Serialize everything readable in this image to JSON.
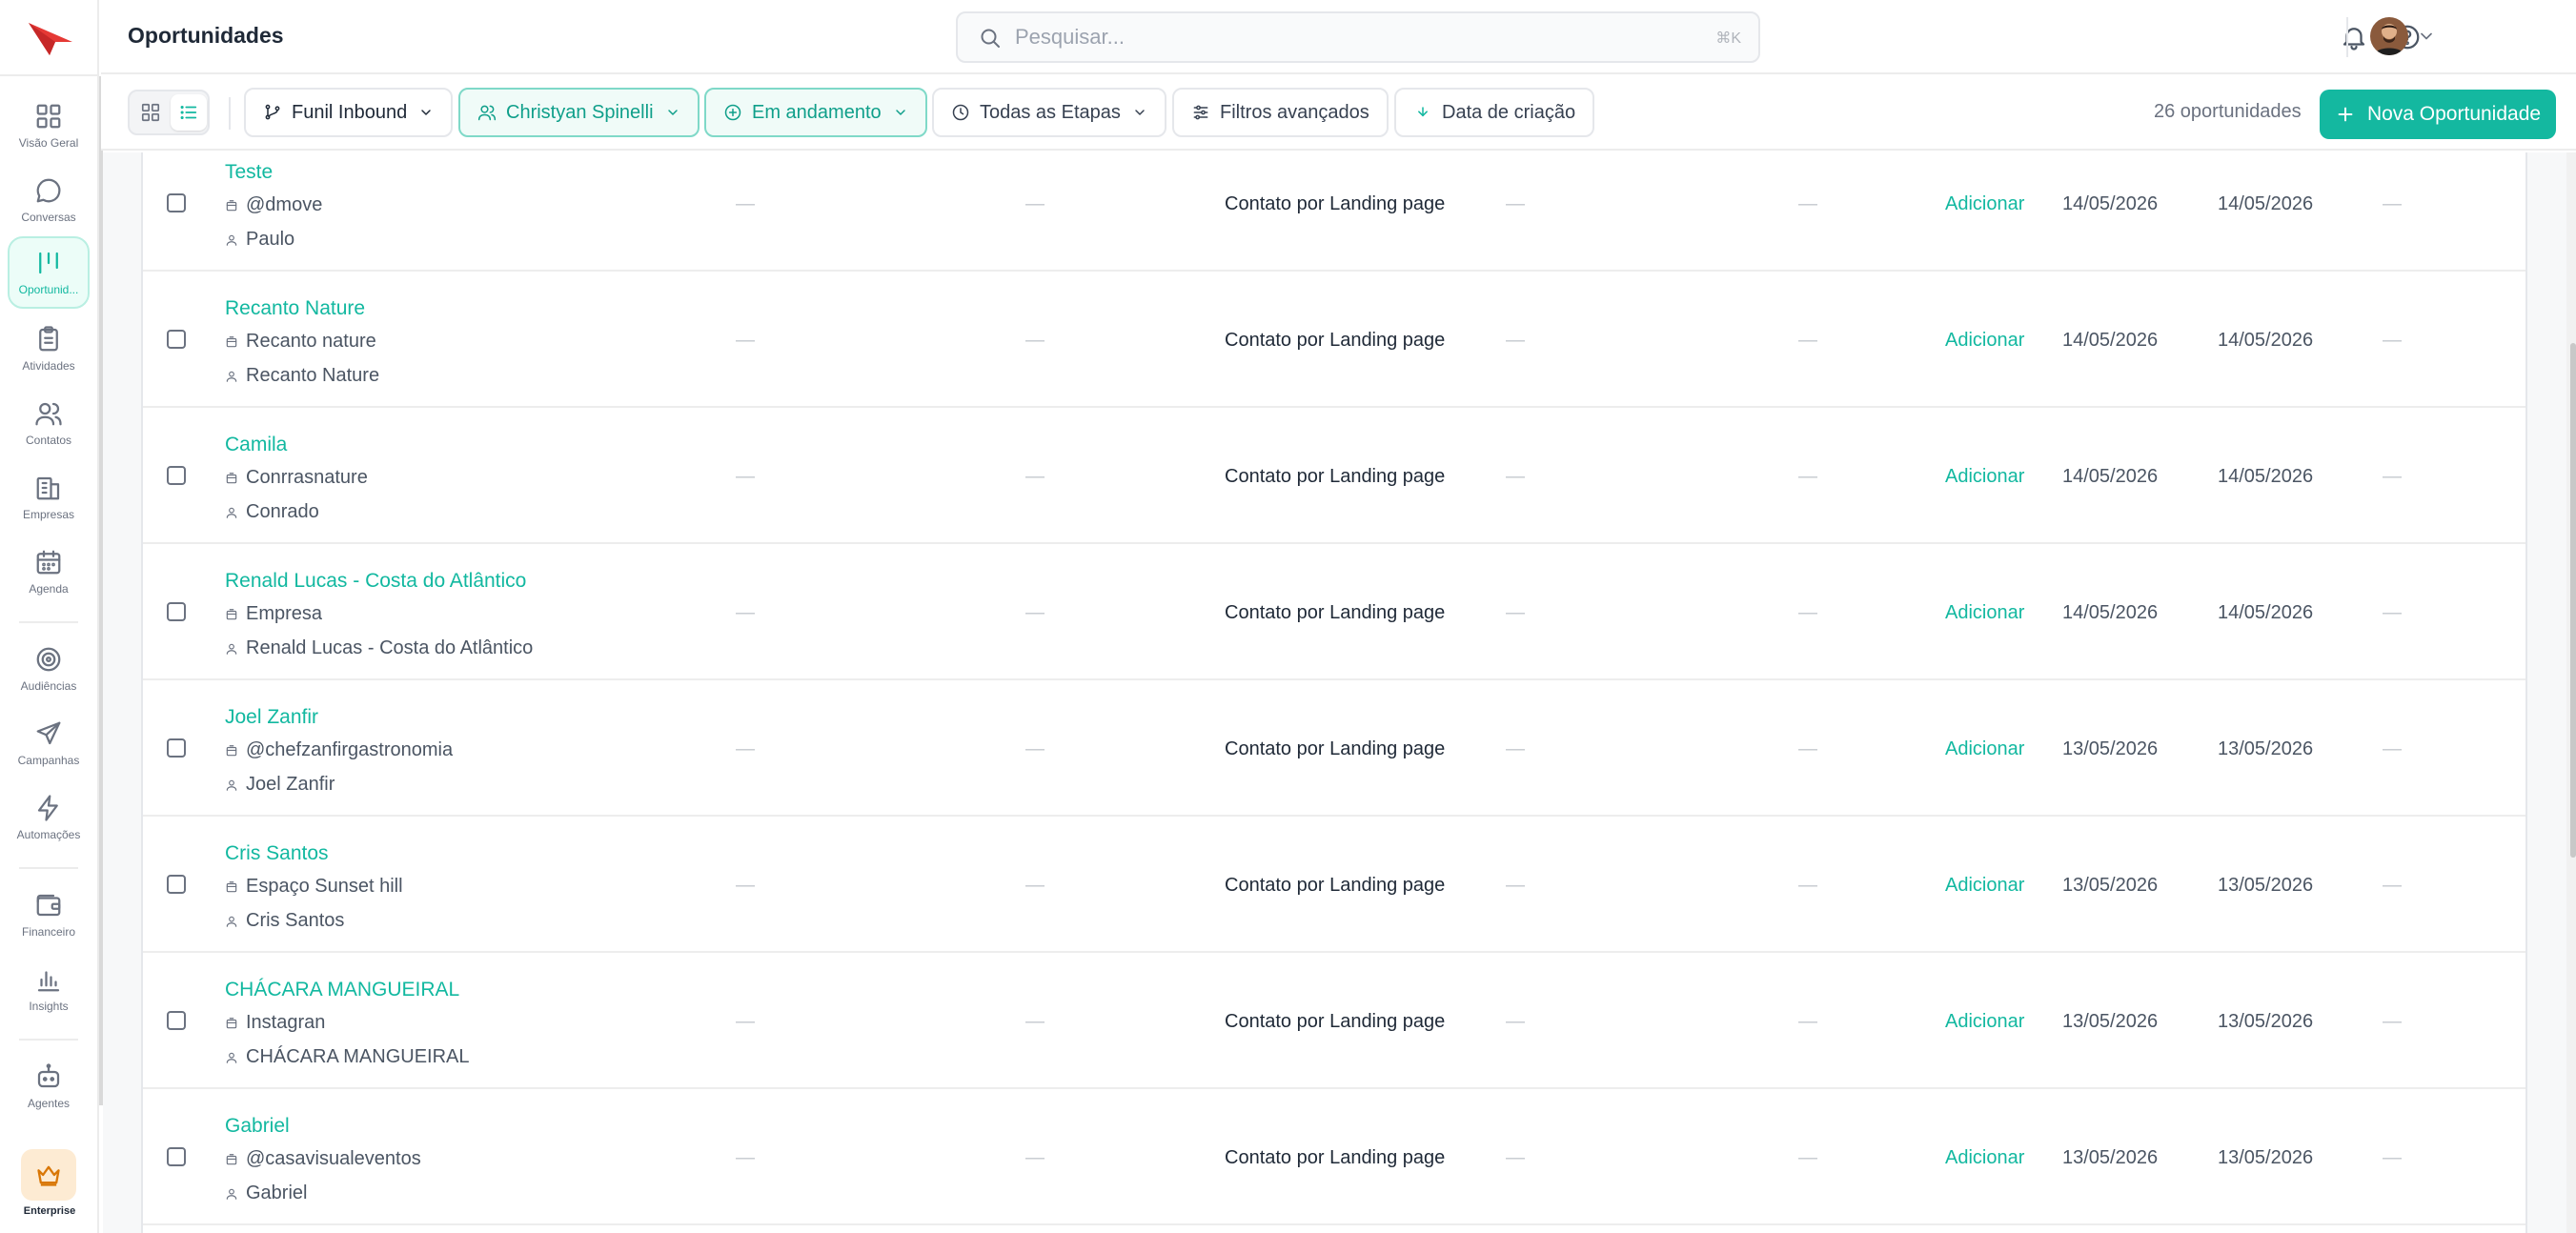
{
  "app": {
    "page_title": "Oportunidades",
    "brand_color": "#14b8a0",
    "logo_color": "#e53935"
  },
  "search": {
    "placeholder": "Pesquisar...",
    "shortcut": "⌘K"
  },
  "sidebar": {
    "items": [
      {
        "label": "Visão Geral",
        "icon": "dashboard-icon",
        "active": false
      },
      {
        "label": "Conversas",
        "icon": "chat-bubble-icon",
        "active": false
      },
      {
        "label": "Oportunid...",
        "icon": "pipeline-icon",
        "active": true
      },
      {
        "label": "Atividades",
        "icon": "clipboard-icon",
        "active": false
      },
      {
        "label": "Contatos",
        "icon": "users-icon",
        "active": false
      },
      {
        "label": "Empresas",
        "icon": "building-icon",
        "active": false
      },
      {
        "label": "Agenda",
        "icon": "calendar-icon",
        "active": false
      },
      {
        "label": "Audiências",
        "icon": "target-icon",
        "active": false
      },
      {
        "label": "Campanhas",
        "icon": "send-icon",
        "active": false
      },
      {
        "label": "Automações",
        "icon": "lightning-icon",
        "active": false
      },
      {
        "label": "Financeiro",
        "icon": "wallet-icon",
        "active": false
      },
      {
        "label": "Insights",
        "icon": "bar-chart-icon",
        "active": false
      },
      {
        "label": "Agentes",
        "icon": "robot-icon",
        "active": false
      }
    ],
    "plan_label": "Enterprise",
    "plan_icon": "crown-icon"
  },
  "toolbar": {
    "filters": [
      {
        "label": "Funil Inbound",
        "icon": "funnel-branch-icon"
      },
      {
        "label": "Christyan Spinelli",
        "icon": "users-icon"
      },
      {
        "label": "Em andamento",
        "icon": "circle-clock-icon"
      },
      {
        "label": "Todas as Etapas",
        "icon": "clock-icon"
      },
      {
        "label": "Filtros avançados",
        "icon": "sliders-icon"
      },
      {
        "label": "Data de criação",
        "icon": "sort-icon"
      }
    ],
    "count_text": "26 oportunidades",
    "new_button_label": "Nova Oportunidade"
  },
  "table": {
    "empty_value": "—",
    "add_label": "Adicionar",
    "rows": [
      {
        "name": "Teste",
        "company": "@dmove",
        "contact": "Paulo",
        "origin": "Contato por Landing page",
        "created": "14/05/2026",
        "updated": "14/05/2026"
      },
      {
        "name": "Recanto Nature",
        "company": "Recanto nature",
        "contact": "Recanto Nature",
        "origin": "Contato por Landing page",
        "created": "14/05/2026",
        "updated": "14/05/2026"
      },
      {
        "name": "Camila",
        "company": "Conrrasnature",
        "contact": "Conrado",
        "origin": "Contato por Landing page",
        "created": "14/05/2026",
        "updated": "14/05/2026"
      },
      {
        "name": "Renald Lucas - Costa do Atlântico",
        "company": "Empresa",
        "contact": "Renald Lucas - Costa do Atlântico",
        "origin": "Contato por Landing page",
        "created": "14/05/2026",
        "updated": "14/05/2026"
      },
      {
        "name": "Joel Zanfir",
        "company": "@chefzanfirgastronomia",
        "contact": "Joel Zanfir",
        "origin": "Contato por Landing page",
        "created": "13/05/2026",
        "updated": "13/05/2026"
      },
      {
        "name": "Cris Santos",
        "company": "Espaço Sunset hill",
        "contact": "Cris Santos",
        "origin": "Contato por Landing page",
        "created": "13/05/2026",
        "updated": "13/05/2026"
      },
      {
        "name": "CHÁCARA MANGUEIRAL",
        "company": "Instagran",
        "contact": "CHÁCARA MANGUEIRAL",
        "origin": "Contato por Landing page",
        "created": "13/05/2026",
        "updated": "13/05/2026"
      },
      {
        "name": "Gabriel",
        "company": "@casavisualeventos",
        "contact": "Gabriel",
        "origin": "Contato por Landing page",
        "created": "13/05/2026",
        "updated": "13/05/2026"
      }
    ]
  }
}
